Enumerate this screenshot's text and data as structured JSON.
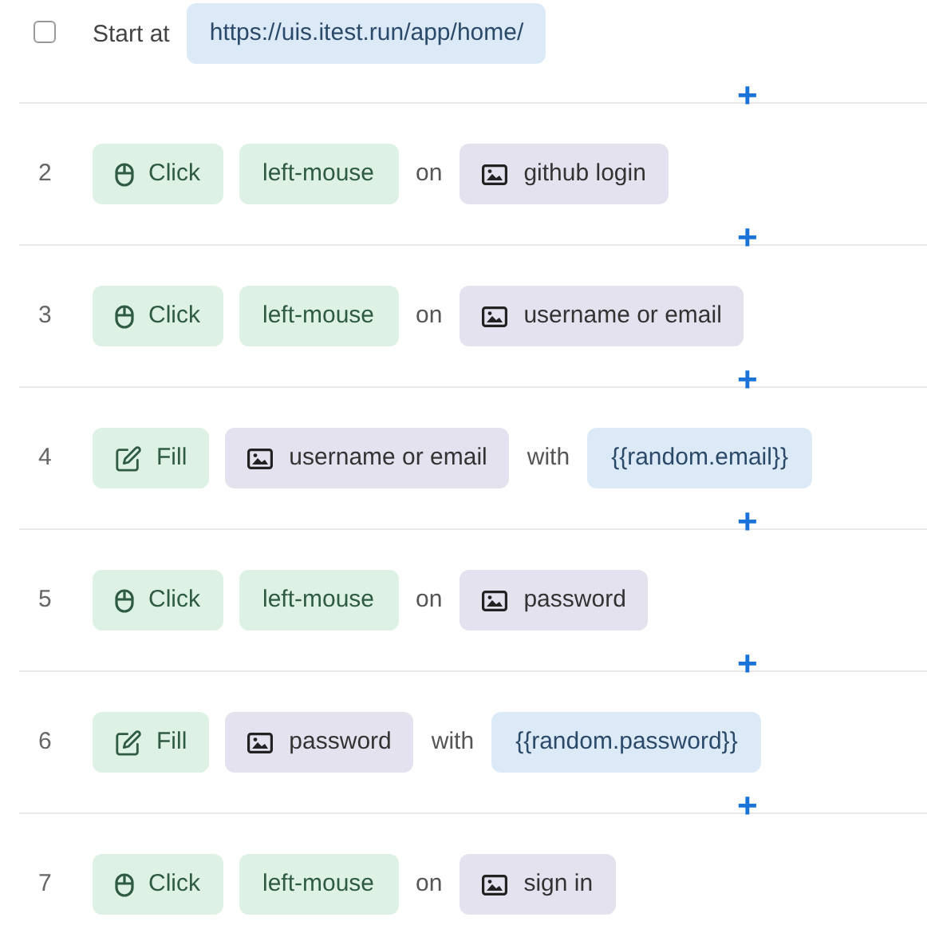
{
  "start": {
    "checked": false,
    "label": "Start at",
    "url": "https://uis.itest.run/app/home/"
  },
  "add_button": "+",
  "steps": [
    {
      "number": "2",
      "action": {
        "kind": "click",
        "label": "Click"
      },
      "parts": [
        {
          "kind": "tag",
          "text": "left-mouse"
        },
        {
          "kind": "word",
          "text": "on"
        },
        {
          "kind": "element",
          "text": "github login"
        }
      ]
    },
    {
      "number": "3",
      "action": {
        "kind": "click",
        "label": "Click"
      },
      "parts": [
        {
          "kind": "tag",
          "text": "left-mouse"
        },
        {
          "kind": "word",
          "text": "on"
        },
        {
          "kind": "element",
          "text": "username or email"
        }
      ]
    },
    {
      "number": "4",
      "action": {
        "kind": "fill",
        "label": "Fill"
      },
      "parts": [
        {
          "kind": "element",
          "text": "username or email"
        },
        {
          "kind": "word",
          "text": "with"
        },
        {
          "kind": "value",
          "text": "{{random.email}}"
        }
      ]
    },
    {
      "number": "5",
      "action": {
        "kind": "click",
        "label": "Click"
      },
      "parts": [
        {
          "kind": "tag",
          "text": "left-mouse"
        },
        {
          "kind": "word",
          "text": "on"
        },
        {
          "kind": "element",
          "text": "password"
        }
      ]
    },
    {
      "number": "6",
      "action": {
        "kind": "fill",
        "label": "Fill"
      },
      "parts": [
        {
          "kind": "element",
          "text": "password"
        },
        {
          "kind": "word",
          "text": "with"
        },
        {
          "kind": "value",
          "text": "{{random.password}}"
        }
      ]
    },
    {
      "number": "7",
      "action": {
        "kind": "click",
        "label": "Click"
      },
      "parts": [
        {
          "kind": "tag",
          "text": "left-mouse"
        },
        {
          "kind": "word",
          "text": "on"
        },
        {
          "kind": "element",
          "text": "sign in"
        }
      ]
    }
  ]
}
